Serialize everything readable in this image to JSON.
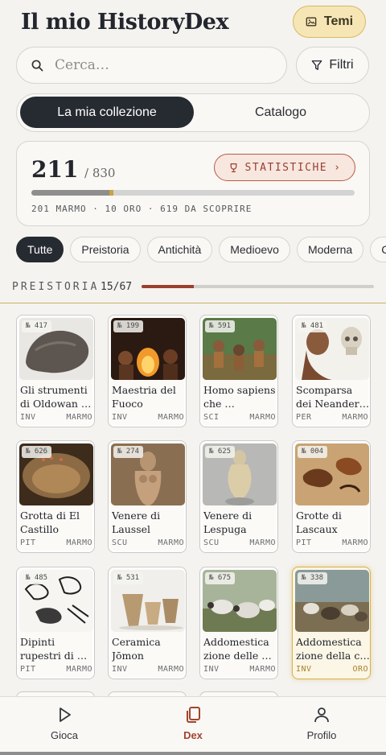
{
  "header": {
    "title": "Il mio HistoryDex",
    "themes_label": "Temi",
    "themes_icon": "image-icon"
  },
  "search": {
    "placeholder": "Cerca…",
    "filters_label": "Filtri"
  },
  "tabs": {
    "collection": "La mia collezione",
    "catalog": "Catalogo"
  },
  "stats": {
    "collected": "211",
    "total": "/ 830",
    "button_label": "STATISTICHE",
    "summary": "201 MARMO · 10 ORO · 619 DA SCOPRIRE",
    "marmo_fraction": 0.242,
    "oro_fraction": 0.012
  },
  "eras": [
    "Tutte",
    "Preistoria",
    "Antichità",
    "Medioevo",
    "Moderna",
    "Co"
  ],
  "section": {
    "label": "PREISTORIA",
    "count": "15/67",
    "fraction": 0.224
  },
  "cards": [
    {
      "num": "№ 417",
      "title": "Gli strumenti di Oldowan …",
      "cat": "INV",
      "tier": "MARMO",
      "img": "stone"
    },
    {
      "num": "№ 199",
      "title": "Maestria del Fuoco",
      "cat": "INV",
      "tier": "MARMO",
      "img": "fire"
    },
    {
      "num": "№ 591",
      "title": "Homo sapiens che …",
      "cat": "SCI",
      "tier": "MARMO",
      "img": "camp"
    },
    {
      "num": "№ 481",
      "title": "Scomparsa dei Neander…",
      "cat": "PER",
      "tier": "MARMO",
      "img": "neander"
    },
    {
      "num": "№ 626",
      "title": "Grotta di El Castillo",
      "cat": "PIT",
      "tier": "MARMO",
      "img": "cave"
    },
    {
      "num": "№ 274",
      "title": "Venere di Laussel",
      "cat": "SCU",
      "tier": "MARMO",
      "img": "relief"
    },
    {
      "num": "№ 625",
      "title": "Venere di Lespuga",
      "cat": "SCU",
      "tier": "MARMO",
      "img": "statue"
    },
    {
      "num": "№ 004",
      "title": "Grotte di Lascaux",
      "cat": "PIT",
      "tier": "MARMO",
      "img": "lascaux"
    },
    {
      "num": "№ 485",
      "title": "Dipinti rupestri di …",
      "cat": "PIT",
      "tier": "MARMO",
      "img": "sketch"
    },
    {
      "num": "№ 531",
      "title": "Ceramica Jōmon",
      "cat": "INV",
      "tier": "MARMO",
      "img": "pottery"
    },
    {
      "num": "№ 675",
      "title": "Addomestica zione delle …",
      "cat": "INV",
      "tier": "MARMO",
      "img": "sheep"
    },
    {
      "num": "№ 338",
      "title": "Addomestica zione della c…",
      "cat": "INV",
      "tier": "ORO",
      "img": "goats"
    }
  ],
  "nav": {
    "play": "Gioca",
    "dex": "Dex",
    "profile": "Profilo"
  },
  "colors": {
    "accent": "#a2452f",
    "gold": "#d8b14e",
    "dark": "#262a31"
  }
}
